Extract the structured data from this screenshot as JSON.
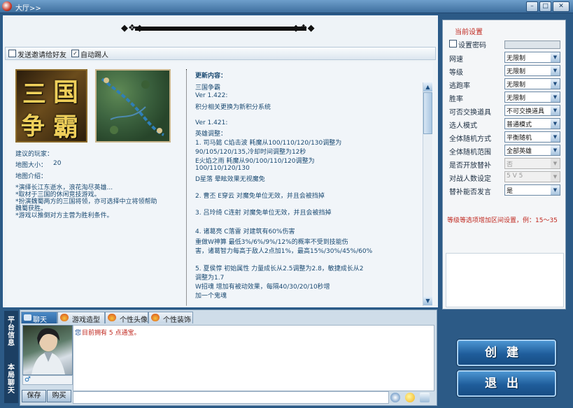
{
  "window": {
    "title": "大厅>>",
    "min": "–",
    "max": "□",
    "close": "✕"
  },
  "toolbar": {
    "invite_label": "发送邀请给好友",
    "invite_checked": false,
    "auto_enter_label": "自动踢人",
    "auto_enter_checked": true
  },
  "map": {
    "title_glyphs": [
      "三",
      "国",
      "争",
      "霸"
    ],
    "players_label": "建议的玩家：",
    "size_label": "地图大小：",
    "size_value": "20",
    "intro_label": "地图介绍：",
    "intro_lines": [
      "*演绎长江东逝水，浪花淘尽英雄...",
      "*取材于三国的休闲竞技游戏。",
      "*扮演魏蜀两方的三国将领，亦可选择中立将领帮助",
      "  魏蜀获胜。",
      "*游戏以推倒对方主营为胜利条件。"
    ]
  },
  "update": {
    "heading": "更新内容：",
    "lines": [
      "三国争霸",
      "Ver 1.422:",
      "积分相关更换为新积分系统",
      "",
      "Ver 1.421:",
      "英雄调整：",
      "1. 司马懿          C焰击波               耗魔从100/110/120/130调整为",
      "90/105/120/135,冷却时间调整为12秒",
      "                         E火焰之雨           耗魔从90/100/110/120调整为",
      "100/110/120/130",
      "                         D星落                 晕眩效果无视魔免",
      "",
      "2. 曹丕              E穿云                 对魔免单位无效，并且会被挡掉",
      "",
      "3. 吕玲绮          C连射                 对魔免单位无效，并且会被挡掉",
      "",
      "4. 诸葛亮          C落雷                 对建筑有60%伤害",
      "                         重做W神算           最低3%/6%/9%/12%的概率不受到技能伤",
      "害，诸葛智力每高于敌人2点加1%，最高15%/30%/45%/60%",
      "",
      "5. 夏侯惇          初始属性             力量成长从2.5调整为2.8，敏捷成长从2",
      "调整为1.7",
      "                         W招魂                 增加有被动效果，每隔40/30/20/10秒增",
      "加一个鬼魂"
    ]
  },
  "settings": {
    "title": "当前设置",
    "password_label": "设置密码",
    "password_checked": false,
    "rows": [
      {
        "label": "网速",
        "value": "无限制",
        "enabled": true
      },
      {
        "label": "等级",
        "value": "无限制",
        "enabled": true
      },
      {
        "label": "逃跑率",
        "value": "无限制",
        "enabled": true
      },
      {
        "label": "胜率",
        "value": "无限制",
        "enabled": true
      },
      {
        "label": "可否交换道具",
        "value": "不可交换道具",
        "enabled": true
      },
      {
        "label": "选人模式",
        "value": "普通模式",
        "enabled": true
      },
      {
        "label": "全体随机方式",
        "value": "平衡随机",
        "enabled": true
      },
      {
        "label": "全体随机范围",
        "value": "全部英雄",
        "enabled": true
      },
      {
        "label": "是否开放替补",
        "value": "否",
        "enabled": false
      },
      {
        "label": "对战人数设定",
        "value": "5 V 5",
        "enabled": false
      },
      {
        "label": "替补能否发言",
        "value": "是",
        "enabled": true
      }
    ],
    "note": "等级等选项增加区间设置，例：15～35"
  },
  "chat": {
    "side_top": [
      "平",
      "台",
      "信",
      "息"
    ],
    "side_bottom": [
      "本",
      "局",
      "聊",
      "天"
    ],
    "tabs": [
      "聊天",
      "游戏造型",
      "个性头像",
      "个性装饰"
    ],
    "message_prefix": "您",
    "message_body": "目前拥有 5 点通宝。",
    "save_label": "保存",
    "buy_label": "购买"
  },
  "actions": {
    "create_label": "创建",
    "exit_label": "退出"
  },
  "colors": {
    "accent_red": "#c0281f",
    "frame_blue": "#2c5a86"
  }
}
